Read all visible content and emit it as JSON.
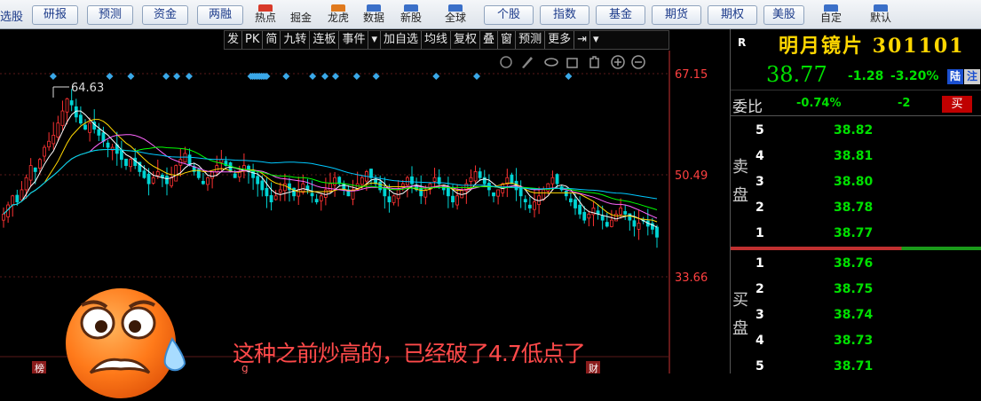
{
  "toolbar": {
    "left_cut": "选股",
    "buttons": [
      {
        "label": "研报"
      },
      {
        "label": "预测"
      },
      {
        "label": "资金"
      },
      {
        "label": "两融"
      }
    ],
    "icons": [
      {
        "label": "热点"
      },
      {
        "label": "掘金"
      },
      {
        "label": "龙虎"
      },
      {
        "label": "数据"
      },
      {
        "label": "新股"
      },
      {
        "label": "全球"
      }
    ],
    "buttons2": [
      {
        "label": "个股"
      },
      {
        "label": "指数"
      },
      {
        "label": "基金"
      },
      {
        "label": "期货"
      },
      {
        "label": "期权"
      },
      {
        "label": "美股"
      }
    ],
    "right": [
      {
        "label": "自定"
      },
      {
        "label": "默认"
      }
    ]
  },
  "chart_toolbar": [
    "发",
    "PK",
    "简",
    "九转",
    "连板",
    "事件",
    "▾",
    "加自选",
    "均线",
    "复权",
    "叠",
    "窗",
    "预测",
    "更多",
    "⇥",
    "▾"
  ],
  "chart_tools": [
    "settings-icon",
    "brush-icon",
    "eye-icon",
    "lock-icon",
    "hand-icon",
    "zoom-in-icon",
    "zoom-out-icon"
  ],
  "chart_data": {
    "type": "candlestick",
    "y_ticks": [
      "67.15",
      "50.49",
      "33.66"
    ],
    "ylim": [
      33.66,
      67.15
    ],
    "high_label": "64.63",
    "bottom_labels": [
      "榜",
      "g",
      "财"
    ],
    "colors": {
      "up": "#ff3232",
      "down": "#00d4d4",
      "ma5": "#ffffff",
      "ma10": "#ffd700",
      "ma20": "#ff66ff",
      "ma30": "#00ff00",
      "ma60": "#00c8ff"
    },
    "closes": [
      44,
      45.5,
      47,
      46,
      48,
      50,
      52,
      51,
      53,
      55,
      56,
      57,
      59,
      61,
      63,
      62,
      60,
      59,
      58,
      59,
      58,
      57,
      56,
      55,
      55,
      54,
      53,
      52,
      53,
      52,
      51,
      50,
      49,
      50,
      51,
      50,
      49,
      50,
      52,
      53,
      54,
      52,
      51,
      50,
      49,
      50,
      51,
      52,
      53,
      52,
      51,
      50,
      51,
      52,
      51,
      50,
      49,
      48,
      47,
      46,
      47,
      48,
      49,
      48,
      47,
      48,
      49,
      48,
      47,
      46,
      47,
      48,
      49,
      50,
      49,
      48,
      47,
      48,
      49,
      50,
      51,
      50,
      49,
      48,
      47,
      46,
      47,
      48,
      49,
      50,
      49,
      48,
      47,
      48,
      49,
      50,
      49,
      48,
      47,
      46,
      47,
      48,
      49,
      50,
      51,
      50,
      49,
      48,
      47,
      48,
      49,
      50,
      49,
      48,
      47,
      46,
      45,
      46,
      47,
      48,
      49,
      50,
      49,
      48,
      47,
      46,
      45,
      44,
      43,
      44,
      45,
      44,
      43,
      42,
      43,
      44,
      45,
      44,
      43,
      42,
      42.5,
      43,
      42,
      41.5,
      40.2
    ]
  },
  "caption": "这种之前炒高的，已经破了4.7低点了",
  "quote": {
    "market": "R",
    "name": "明月镜片 301101",
    "price": "38.77",
    "change": "-1.28",
    "change_pct": "-3.20%",
    "tag1": "陆",
    "tag2": "注",
    "weibi_label": "委比",
    "weibi": "-0.74%",
    "weicha": "-2",
    "buy_label": "买",
    "sell_side_label": "卖盘",
    "buy_side_label": "买盘",
    "asks": [
      {
        "level": "5",
        "price": "38.82"
      },
      {
        "level": "4",
        "price": "38.81"
      },
      {
        "level": "3",
        "price": "38.80"
      },
      {
        "level": "2",
        "price": "38.78"
      },
      {
        "level": "1",
        "price": "38.77"
      }
    ],
    "bids": [
      {
        "level": "1",
        "price": "38.76"
      },
      {
        "level": "2",
        "price": "38.75"
      },
      {
        "level": "3",
        "price": "38.74"
      },
      {
        "level": "4",
        "price": "38.73"
      },
      {
        "level": "5",
        "price": "38.71"
      }
    ]
  }
}
